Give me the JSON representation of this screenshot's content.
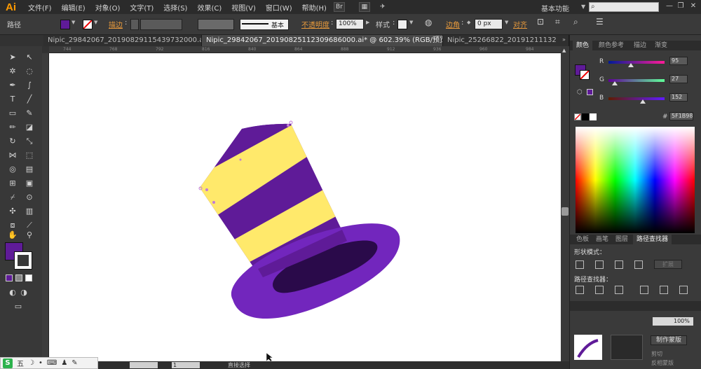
{
  "app": {
    "logo": "Ai"
  },
  "menu": {
    "items": [
      "文件(F)",
      "编辑(E)",
      "对象(O)",
      "文字(T)",
      "选择(S)",
      "效果(C)",
      "视图(V)",
      "窗口(W)",
      "帮助(H)"
    ],
    "workspace": "基本功能"
  },
  "controlbar": {
    "selection_label": "路径",
    "stroke_label": "描边",
    "stroke_style": "基本",
    "opacity_label": "不透明度",
    "opacity_value": "100%",
    "style_label": "样式",
    "corner_label": "边角",
    "corner_value": "0 px",
    "align_label": "对齐",
    "fill_color": "#5F1B98"
  },
  "tabs": [
    {
      "label": "Nipic_29842067_20190829115439732000.ai*",
      "close": "×",
      "active": false
    },
    {
      "label": "Nipic_29842067_20190825112309686000.ai* @ 602.39% (RGB/预览)",
      "close": "×",
      "active": true
    },
    {
      "label": "Nipic_25266822_20191211132",
      "close": "",
      "active": false
    }
  ],
  "ruler_ticks": [
    "744",
    "768",
    "792",
    "816",
    "840",
    "864",
    "888",
    "912",
    "936",
    "960",
    "984"
  ],
  "canvas": {
    "hat_colors": {
      "purple": "#5F1B98",
      "yellow": "#FFE96B",
      "brim": "#7226BD",
      "inner": "#2A0A4A"
    }
  },
  "color_panel": {
    "tabs": [
      "颜色",
      "颜色参考",
      "描边",
      "渐变"
    ],
    "r_label": "R",
    "r_value": "95",
    "g_label": "G",
    "g_value": "27",
    "b_label": "B",
    "b_value": "152",
    "hex_prefix": "#",
    "hex": "5F1B98"
  },
  "pathfinder_panel": {
    "tabs": [
      "色板",
      "画笔",
      "图层",
      "路径查找器"
    ],
    "shape_modes_label": "形状模式：",
    "pathfinders_label": "路径查找器：",
    "expand_label": "扩展"
  },
  "transparency_panel": {
    "opacity_value": "100%",
    "make_mask_label": "制作蒙版",
    "clip_label": "剪切",
    "invert_label": "反相蒙版"
  },
  "statusbar": {
    "tool_text": "直接选择",
    "page_value": "1"
  },
  "taskbar": {
    "logo": "S",
    "item": "五"
  }
}
